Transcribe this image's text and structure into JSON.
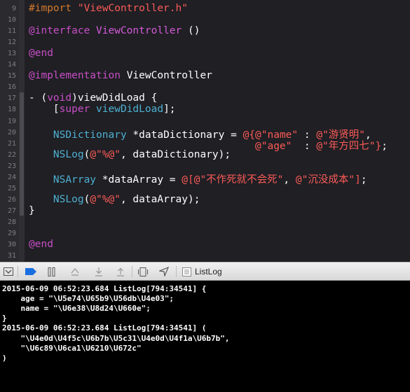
{
  "editor": {
    "lines": [
      {
        "num": "9",
        "segments": [
          {
            "cls": "pp",
            "text": "#import "
          },
          {
            "cls": "str",
            "text": "\"ViewController.h\""
          }
        ]
      },
      {
        "num": "10",
        "segments": []
      },
      {
        "num": "11",
        "segments": [
          {
            "cls": "kw",
            "text": "@interface "
          },
          {
            "cls": "cls",
            "text": "ViewController"
          },
          {
            "cls": "plain",
            "text": " ()"
          }
        ]
      },
      {
        "num": "12",
        "segments": []
      },
      {
        "num": "13",
        "segments": [
          {
            "cls": "kw",
            "text": "@end"
          }
        ]
      },
      {
        "num": "14",
        "segments": []
      },
      {
        "num": "15",
        "segments": [
          {
            "cls": "kw",
            "text": "@implementation "
          },
          {
            "cls": "plain",
            "text": "ViewController"
          }
        ]
      },
      {
        "num": "16",
        "segments": []
      },
      {
        "num": "17",
        "segments": [
          {
            "cls": "plain",
            "text": "- ("
          },
          {
            "cls": "kw",
            "text": "void"
          },
          {
            "cls": "plain",
            "text": ")viewDidLoad {"
          }
        ]
      },
      {
        "num": "18",
        "segments": [
          {
            "cls": "plain",
            "text": "    ["
          },
          {
            "cls": "kw",
            "text": "super"
          },
          {
            "cls": "plain",
            "text": " "
          },
          {
            "cls": "ty",
            "text": "viewDidLoad"
          },
          {
            "cls": "plain",
            "text": "];"
          }
        ]
      },
      {
        "num": "19",
        "segments": []
      },
      {
        "num": "20",
        "segments": [
          {
            "cls": "plain",
            "text": "    "
          },
          {
            "cls": "ty",
            "text": "NSDictionary"
          },
          {
            "cls": "plain",
            "text": " *dataDictionary = "
          },
          {
            "cls": "str",
            "text": "@{@\"name\""
          },
          {
            "cls": "plain",
            "text": " : "
          },
          {
            "cls": "str",
            "text": "@\"游贤明\""
          },
          {
            "cls": "plain",
            "text": ","
          }
        ]
      },
      {
        "num": "21",
        "segments": [
          {
            "cls": "plain",
            "text": "                                     "
          },
          {
            "cls": "str",
            "text": "@\"age\""
          },
          {
            "cls": "plain",
            "text": "  : "
          },
          {
            "cls": "str",
            "text": "@\"年方四七\""
          },
          {
            "cls": "str",
            "text": "}"
          },
          {
            "cls": "plain",
            "text": ";"
          }
        ]
      },
      {
        "num": "22",
        "segments": [
          {
            "cls": "plain",
            "text": "    "
          },
          {
            "cls": "ty",
            "text": "NSLog"
          },
          {
            "cls": "plain",
            "text": "("
          },
          {
            "cls": "str",
            "text": "@\"%@\""
          },
          {
            "cls": "plain",
            "text": ", dataDictionary);"
          }
        ]
      },
      {
        "num": "23",
        "segments": []
      },
      {
        "num": "24",
        "segments": [
          {
            "cls": "plain",
            "text": "    "
          },
          {
            "cls": "ty",
            "text": "NSArray"
          },
          {
            "cls": "plain",
            "text": " *dataArray = "
          },
          {
            "cls": "str",
            "text": "@["
          },
          {
            "cls": "str",
            "text": "@\"不作死就不会死\""
          },
          {
            "cls": "plain",
            "text": ", "
          },
          {
            "cls": "str",
            "text": "@\"沉没成本\""
          },
          {
            "cls": "str",
            "text": "]"
          },
          {
            "cls": "plain",
            "text": ";"
          }
        ]
      },
      {
        "num": "25",
        "segments": []
      },
      {
        "num": "26",
        "segments": [
          {
            "cls": "plain",
            "text": "    "
          },
          {
            "cls": "ty",
            "text": "NSLog"
          },
          {
            "cls": "plain",
            "text": "("
          },
          {
            "cls": "str",
            "text": "@\"%@\""
          },
          {
            "cls": "plain",
            "text": ", dataArray);"
          }
        ]
      },
      {
        "num": "27",
        "segments": [
          {
            "cls": "plain",
            "text": "}"
          }
        ]
      },
      {
        "num": "28",
        "segments": []
      },
      {
        "num": "29",
        "segments": []
      },
      {
        "num": "30",
        "segments": [
          {
            "cls": "kw",
            "text": "@end"
          }
        ]
      },
      {
        "num": "31",
        "segments": []
      }
    ]
  },
  "debugbar": {
    "target_label": "ListLog",
    "buttons": [
      {
        "name": "hide-debug-area-icon"
      },
      {
        "name": "breakpoints-toggle-icon"
      },
      {
        "name": "pause-icon"
      },
      {
        "name": "step-over-icon"
      },
      {
        "name": "step-into-icon"
      },
      {
        "name": "step-out-icon"
      },
      {
        "name": "view-hierarchy-icon"
      },
      {
        "name": "simulate-location-icon"
      },
      {
        "name": "target-icon"
      }
    ]
  },
  "console": {
    "lines": [
      "2015-06-09 06:52:23.684 ListLog[794:34541] {",
      "    age = \"\\U5e74\\U65b9\\U56db\\U4e03\";",
      "    name = \"\\U6e38\\U8d24\\U660e\";",
      "}",
      "2015-06-09 06:52:23.684 ListLog[794:34541] (",
      "    \"\\U4e0d\\U4f5c\\U6b7b\\U5c31\\U4e0d\\U4f1a\\U6b7b\",",
      "    \"\\U6c89\\U6ca1\\U6210\\U672c\"",
      ")"
    ]
  },
  "colors": {
    "editor_bg": "#1f1f24",
    "keyword": "#c94ec6",
    "string": "#fc5b57",
    "type": "#4fb0d1",
    "preprocessor": "#d4792c"
  }
}
